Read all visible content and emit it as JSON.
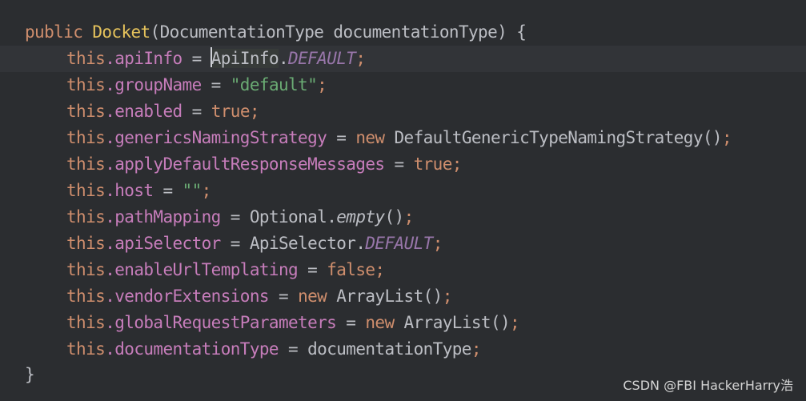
{
  "code": {
    "line1": {
      "kw_public": "public",
      "method_name": "Docket",
      "params": "(DocumentationType documentationType) {"
    },
    "line2": {
      "this": "this",
      "field": ".apiInfo",
      "assign": " = ",
      "cursor_char": "A",
      "class_rest": "piInfo",
      "dot": ".",
      "constant": "DEFAULT",
      "semi": ";"
    },
    "line3": {
      "this": "this",
      "field": ".groupName",
      "assign": " = ",
      "string": "\"default\"",
      "semi": ";"
    },
    "line4": {
      "this": "this",
      "field": ".enabled",
      "assign": " = ",
      "value": "true",
      "semi": ";"
    },
    "line5": {
      "this": "this",
      "field": ".genericsNamingStrategy",
      "assign": " = ",
      "kw_new": "new",
      "rest": " DefaultGenericTypeNamingStrategy()",
      "semi": ";"
    },
    "line6": {
      "this": "this",
      "field": ".applyDefaultResponseMessages",
      "assign": " = ",
      "value": "true",
      "semi": ";"
    },
    "line7": {
      "this": "this",
      "field": ".host",
      "assign": " = ",
      "string": "\"\"",
      "semi": ";"
    },
    "line8": {
      "this": "this",
      "field": ".pathMapping",
      "assign": " = ",
      "class": "Optional.",
      "static_method": "empty",
      "parens": "()",
      "semi": ";"
    },
    "line9": {
      "this": "this",
      "field": ".apiSelector",
      "assign": " = ",
      "class": "ApiSelector.",
      "constant": "DEFAULT",
      "semi": ";"
    },
    "line10": {
      "this": "this",
      "field": ".enableUrlTemplating",
      "assign": " = ",
      "value": "false",
      "semi": ";"
    },
    "line11": {
      "this": "this",
      "field": ".vendorExtensions",
      "assign": " = ",
      "kw_new": "new",
      "rest": " ArrayList()",
      "semi": ";"
    },
    "line12": {
      "this": "this",
      "field": ".globalRequestParameters",
      "assign": " = ",
      "kw_new": "new",
      "rest": " ArrayList()",
      "semi": ";"
    },
    "line13": {
      "this": "this",
      "field": ".documentationType",
      "assign": " = ",
      "rest": "documentationType",
      "semi": ";"
    },
    "line14": {
      "brace": "}"
    }
  },
  "watermark": "CSDN @FBI HackerHarry浩",
  "colors": {
    "background": "#2b2d30",
    "keyword": "#cf8e6d",
    "field": "#c77dbb",
    "string": "#6aab73",
    "constant": "#9876aa",
    "default_text": "#bcbec4",
    "method_decl": "#e6c35c"
  }
}
